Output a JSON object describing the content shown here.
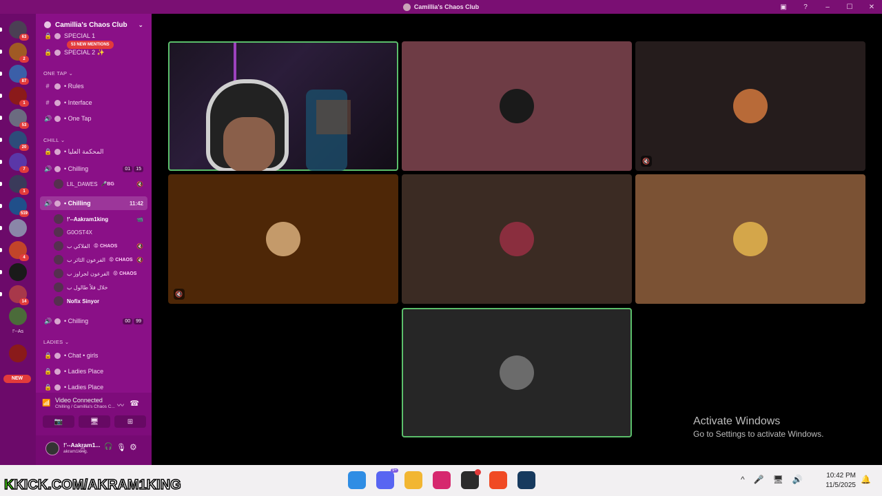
{
  "window": {
    "title": "Camillia's Chaos Club",
    "controls": [
      "▣",
      "?",
      "–",
      "☐",
      "✕"
    ]
  },
  "rail": {
    "servers": [
      {
        "color": "#4b3f54",
        "badge": "63"
      },
      {
        "color": "#a05a24",
        "badge": "2"
      },
      {
        "color": "#3b5fa8",
        "badge": "87"
      },
      {
        "color": "#8b1a1a",
        "badge": "1"
      },
      {
        "color": "#6b6b80",
        "badge": "53"
      },
      {
        "color": "#2d4b7a",
        "badge": "20"
      },
      {
        "color": "#5a37a8",
        "badge": "7"
      },
      {
        "color": "#3a3a5a",
        "badge": "1"
      },
      {
        "color": "#204f8a",
        "badge": "519"
      },
      {
        "color": "#8a86a8",
        "badge": ""
      },
      {
        "color": "#c2442a",
        "badge": "4"
      },
      {
        "color": "#1a1a1a",
        "badge": ""
      },
      {
        "color": "#a8384a",
        "badge": "14"
      },
      {
        "color": "#4b6b3a",
        "badge": ""
      },
      {
        "color": "#8a1a1a",
        "badge": ""
      }
    ],
    "folder_label": "!'--As",
    "new_label": "NEW"
  },
  "sidebar": {
    "server_name": "Camillia's Chaos Club",
    "mentions": "53 NEW MENTIONS",
    "top_channels": [
      {
        "icon": "🔒",
        "name": "SPECIAL 1"
      },
      {
        "icon": "🔒",
        "name": "SPECIAL 2 ✨"
      }
    ],
    "categories": {
      "one_tap": "ONE TAP ⌄",
      "chill": "CHILL ⌄",
      "ladies": "LADIES ⌄"
    },
    "one_tap_channels": [
      {
        "icon": "#",
        "name": "• Rules"
      },
      {
        "icon": "#",
        "name": "• Interface"
      },
      {
        "icon": "🔊",
        "name": "• One Tap"
      }
    ],
    "chill_channels": [
      {
        "icon": "🔒",
        "name": "• المحكمة العليا"
      },
      {
        "icon": "🔊",
        "name": "• Chilling",
        "c1": "01",
        "c2": "15"
      }
    ],
    "chill_user": {
      "name": "LIL_DAWES",
      "tag": "🎤BG",
      "icon": "🔇"
    },
    "active_channel": {
      "icon": "🔊",
      "name": "• Chilling",
      "time": "11:42"
    },
    "active_users": [
      {
        "name": "!'--Aakram1king",
        "tag": "",
        "icon": "📹",
        "bold": true
      },
      {
        "name": "G0OST4X",
        "tag": "",
        "icon": "",
        "bold": false
      },
      {
        "name": "الفلاكي ب",
        "tag": "😡 CHAOS",
        "icon": "🔇",
        "bold": false
      },
      {
        "name": "الفرعون الثائر ب",
        "tag": "😡 CHAOS",
        "icon": "🔇",
        "bold": false
      },
      {
        "name": "الفرعون لجراوز ب",
        "tag": "😡 CHAOS",
        "icon": "",
        "bold": false
      },
      {
        "name": "خلال فلأ طالول ب",
        "tag": "",
        "icon": "",
        "bold": false
      },
      {
        "name": "Nofix Sinyor",
        "tag": "",
        "icon": "",
        "bold": true
      }
    ],
    "chill_channel_3": {
      "icon": "🔊",
      "name": "• Chilling",
      "c1": "00",
      "c2": "99"
    },
    "ladies_channels": [
      {
        "icon": "🔒",
        "name": "• Chat • girls"
      },
      {
        "icon": "🔒",
        "name": "• Ladies Place"
      },
      {
        "icon": "🔒",
        "name": "• Ladies Place"
      }
    ]
  },
  "voice": {
    "status": "Video Connected",
    "sub": "Chilling / Camillia's Chaos C...",
    "buttons": [
      "📷",
      "🖥",
      "⊞"
    ]
  },
  "user": {
    "name": "!'--Aakram1...",
    "handle": "akram1king."
  },
  "tiles": [
    {
      "kind": "camera",
      "bg": "#1b1422",
      "speaking": true,
      "muted": false,
      "avatar": ""
    },
    {
      "kind": "avatar",
      "bg": "#6e3c45",
      "speaking": false,
      "muted": false,
      "avatar": "#1a1a1a"
    },
    {
      "kind": "avatar",
      "bg": "#251c1c",
      "speaking": false,
      "muted": true,
      "avatar": "#b86a38"
    },
    {
      "kind": "avatar",
      "bg": "#4e2707",
      "speaking": false,
      "muted": true,
      "avatar": "#c49a6a"
    },
    {
      "kind": "avatar",
      "bg": "#3b2b23",
      "speaking": false,
      "muted": false,
      "avatar": "#8a2e3e"
    },
    {
      "kind": "avatar",
      "bg": "#7b5234",
      "speaking": false,
      "muted": false,
      "avatar": "#d4a64a"
    },
    {
      "kind": "avatar",
      "bg": "#262626",
      "speaking": true,
      "muted": false,
      "avatar": "#6b6b6b"
    }
  ],
  "watermark": {
    "line1": "Activate Windows",
    "line2": "Go to Settings to activate Windows."
  },
  "taskbar": {
    "kick_prefix": "K",
    "kick_text": "KICK.COM/AKRAM1KING",
    "apps": [
      {
        "name": "windows-start-icon",
        "color": "#2f8de4"
      },
      {
        "name": "discord-icon",
        "color": "#5865f2"
      },
      {
        "name": "file-explorer-icon",
        "color": "#f2b632"
      },
      {
        "name": "instagram-icon",
        "color": "#d6286e"
      },
      {
        "name": "obs-icon",
        "color": "#2b2b2b"
      },
      {
        "name": "brave-icon",
        "color": "#f04a24"
      },
      {
        "name": "steam-icon",
        "color": "#173a5e"
      }
    ],
    "discord_badge": "9+",
    "tray": [
      "^",
      "🎤",
      "🖥",
      "🔊"
    ],
    "time": "10:42 PM",
    "date": "11/5/2025",
    "notif": "🔔"
  }
}
